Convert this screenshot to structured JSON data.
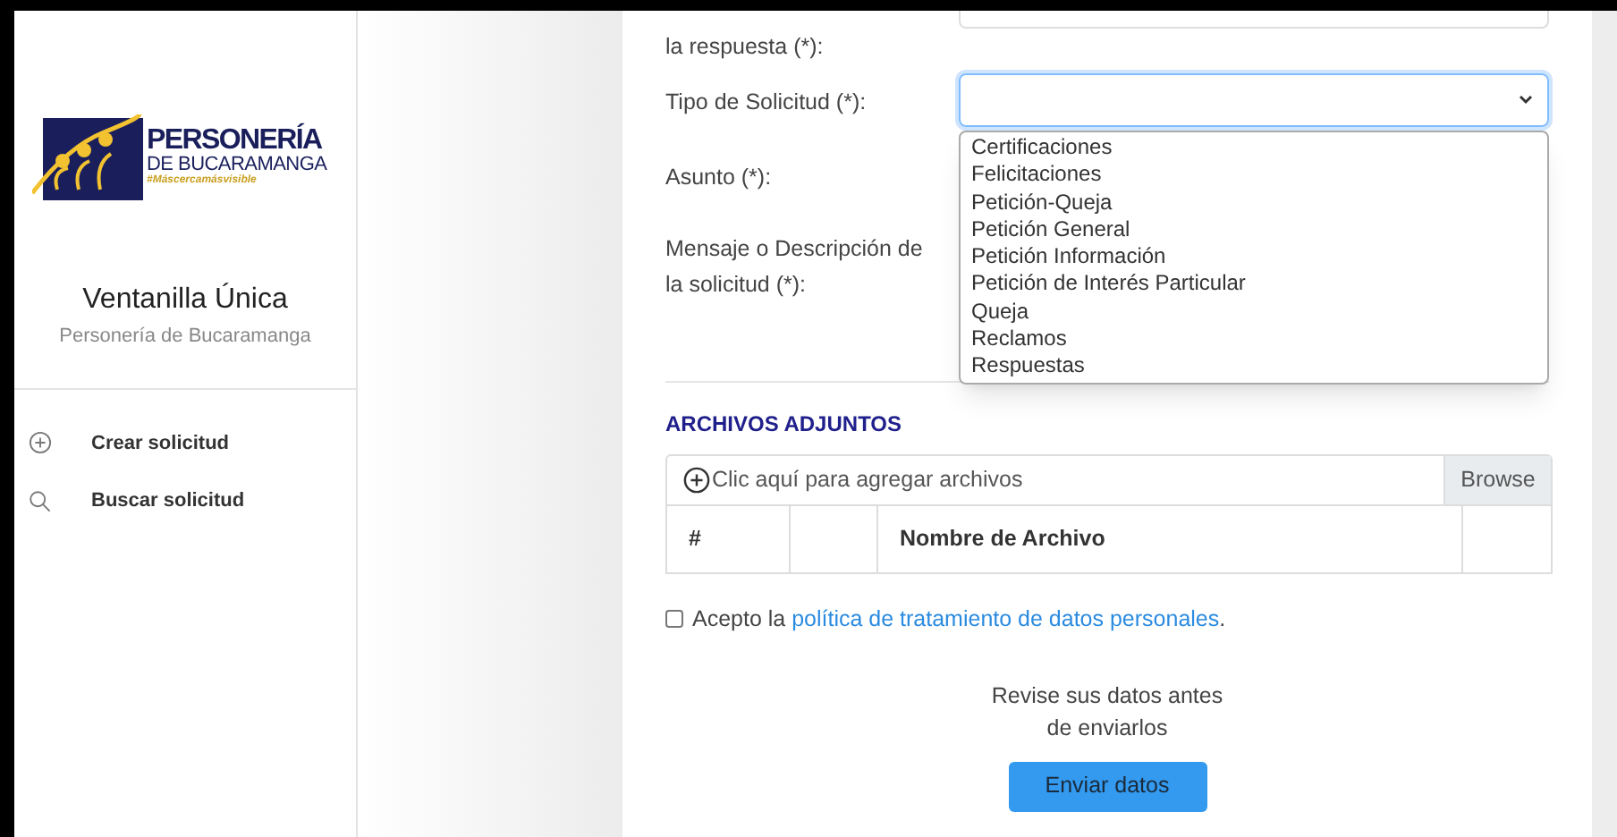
{
  "sidebar": {
    "logo": {
      "line_1": "PERSONERÍA",
      "line_2": "DE BUCARAMANGA",
      "tagline": "#Máscercamásvisible"
    },
    "title": "Ventanilla Única",
    "subtitle": "Personería de Bucaramanga",
    "items": [
      {
        "label": "Crear solicitud"
      },
      {
        "label": "Buscar solicitud"
      }
    ]
  },
  "form": {
    "fields": [
      {
        "kind": "input",
        "label": "la respuesta (*):"
      },
      {
        "kind": "select",
        "label": "Tipo de Solicitud (*):",
        "focused": true,
        "expanded": true,
        "options": [
          {
            "label": "Certificaciones",
            "selected": false
          },
          {
            "label": "Felicitaciones",
            "selected": false
          },
          {
            "label": "Petición-Queja",
            "selected": false
          },
          {
            "label": "Petición General",
            "selected": false
          },
          {
            "label": "Petición Información",
            "selected": false
          },
          {
            "label": "Petición de Interés Particular",
            "selected": false
          },
          {
            "label": "Queja",
            "selected": false
          },
          {
            "label": "Reclamos",
            "selected": false
          },
          {
            "label": "Respuestas",
            "selected": false
          }
        ]
      },
      {
        "kind": "covered",
        "label": "Asunto (*):"
      },
      {
        "kind": "covered",
        "label": "Mensaje o Descripción de la solicitud (*):"
      }
    ],
    "attachments": {
      "heading": "ARCHIVOS ADJUNTOS",
      "placeholder": "Clic aquí para agregar archivos",
      "browse": "Browse",
      "columns": [
        "#",
        "",
        "Nombre de Archivo",
        ""
      ]
    },
    "consent": {
      "checked": false,
      "text": "Acepto la",
      "link": "política de tratamiento de datos personales",
      "suffix": "."
    },
    "note": "Revise sus datos antes de enviarlos",
    "submit": "Enviar datos"
  }
}
